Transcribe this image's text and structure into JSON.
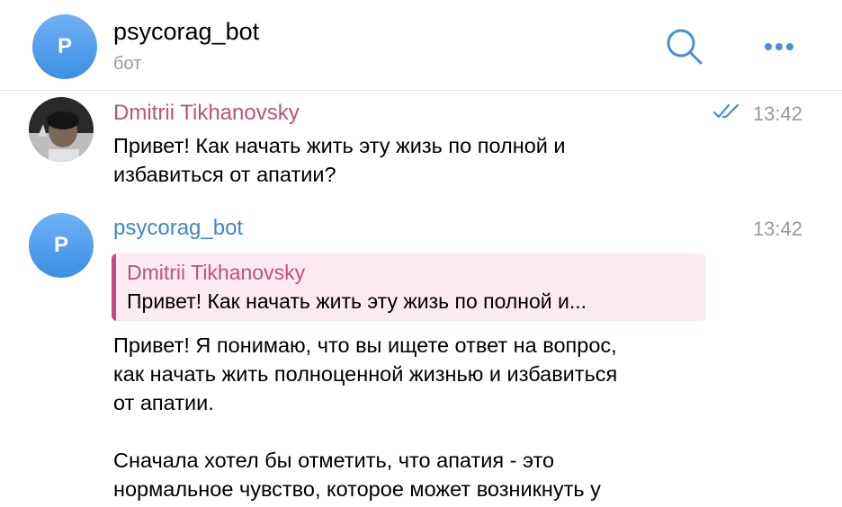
{
  "header": {
    "avatar_letter": "P",
    "title": "psycorag_bot",
    "subtitle": "бот"
  },
  "messages": [
    {
      "sender": "Dmitrii Tikhanovsky",
      "time": "13:42",
      "lines": [
        "Привет! Как начать жить эту жизь по полной и",
        "избавиться от апатии?"
      ],
      "sender_color": "#c0507f",
      "read_icon": "double-check-icon"
    },
    {
      "avatar_letter": "P",
      "sender": "psycorag_bot",
      "time": "13:42",
      "sender_color": "#3d86cf",
      "reply": {
        "sender": "Dmitrii Tikhanovsky",
        "text": "Привет! Как начать жить эту жизь по полной и..."
      },
      "lines": [
        "Привет! Я понимаю, что вы ищете ответ на вопрос,",
        "как начать жить полноценной жизнью и избавиться",
        "от апатии.",
        "",
        "Сначала хотел бы отметить, что апатия - это",
        "нормальное чувство, которое может возникнуть у"
      ]
    }
  ],
  "colors": {
    "avatar_gradient_top": "#6fb1f5",
    "avatar_gradient_bottom": "#3b8fe3",
    "accent": "#4a8fd6",
    "reply_bg": "#fbeaf1",
    "reply_bar": "#c74a86",
    "muted": "#9a9a9a"
  }
}
